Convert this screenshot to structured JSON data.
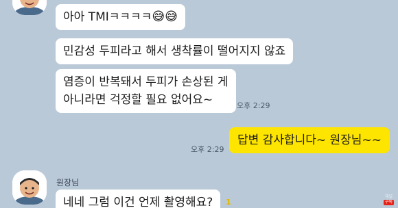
{
  "chat": {
    "sender_name": "원장님",
    "messages": [
      {
        "from": "other",
        "text": "아아 TMIㅋㅋㅋㅋ",
        "emoji": "😅😅"
      },
      {
        "from": "other",
        "text": "민감성 두피라고 해서 생착률이 떨어지지 않죠"
      },
      {
        "from": "other",
        "line1": "염증이 반복돼서 두피가 손상된 게",
        "line2": "아니라면 걱정할 필요 없어요~",
        "time": "오후 2:29"
      },
      {
        "from": "me",
        "text": "답변 감사합니다~ 원장님~~",
        "time": "오후 2:29"
      },
      {
        "from": "other",
        "text": "네네 그럼 이건 언제 촬영해요?",
        "unread": "1"
      }
    ]
  },
  "watermark": {
    "channel": "채널",
    "badge": "구독"
  },
  "colors": {
    "background": "#bac9d8",
    "my_bubble": "#fee500",
    "other_bubble": "#ffffff"
  },
  "icons": [
    "doctor-avatar-icon"
  ]
}
